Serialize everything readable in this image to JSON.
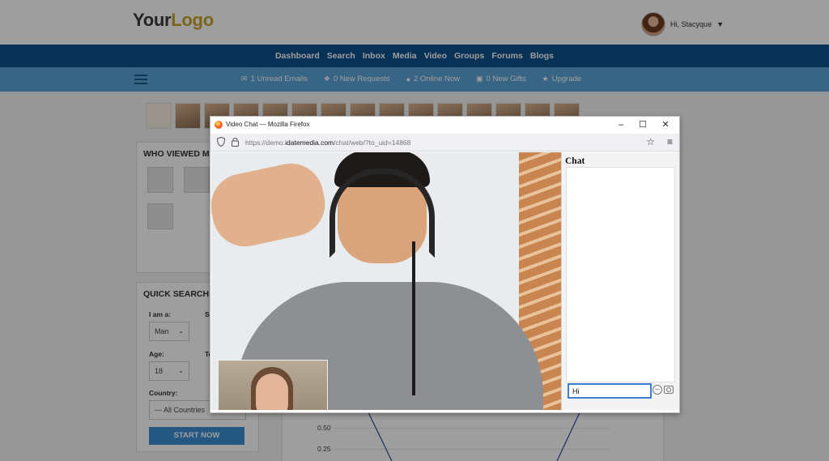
{
  "site": {
    "logo_part1": "Your",
    "logo_part2": "Logo",
    "user_greeting": "Hi, Stacyque",
    "nav": [
      "Dashboard",
      "Search",
      "Inbox",
      "Media",
      "Video",
      "Groups",
      "Forums",
      "Blogs"
    ],
    "subbar": [
      {
        "icon": "envelope-icon",
        "label": "1 Unread Emails"
      },
      {
        "icon": "request-icon",
        "label": "0 New Requests"
      },
      {
        "icon": "online-icon",
        "label": "2 Online Now"
      },
      {
        "icon": "gift-icon",
        "label": "0 New Gifts"
      },
      {
        "icon": "upgrade-icon",
        "label": "Upgrade"
      }
    ],
    "who_viewed_title": "WHO VIEWED M",
    "quick_search": {
      "title": "QUICK SEARCH",
      "i_am_label": "I am a:",
      "i_am_value": "Man",
      "age_label": "Age:",
      "age_value": "18",
      "country_label": "Country:",
      "country_value": "--- All Countries",
      "start_button": "START NOW",
      "partial_label_1": "Se",
      "partial_label_2": "To"
    },
    "chart_ticks": [
      "0.50",
      "0.25"
    ]
  },
  "popup": {
    "window_title": "Video Chat — Mozilla Firefox",
    "url_prefix": "https://demo.",
    "url_host": "idatemedia.com",
    "url_path": "/chat/web/?to_uid=14868",
    "chat": {
      "title": "Chat",
      "input_value": "Hi"
    }
  },
  "colors": {
    "nav_bg": "#0e4f8b",
    "subbar_bg": "#5ba3d9",
    "logo_accent": "#c9a227",
    "button_blue": "#3a8ed3"
  }
}
